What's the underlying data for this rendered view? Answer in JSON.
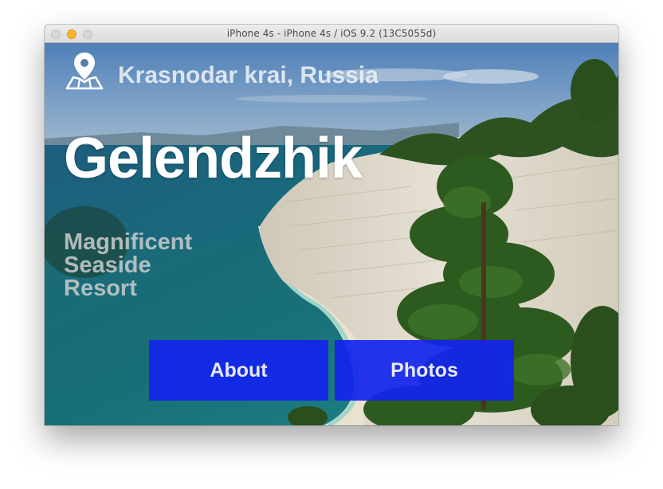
{
  "window": {
    "title": "iPhone 4s - iPhone 4s / iOS 9.2 (13C5055d)"
  },
  "screen": {
    "location": "Krasnodar krai, Russia",
    "location_icon": "map-pin-icon",
    "city": "Gelendzhik",
    "tagline": [
      "Magnificent",
      "Seaside",
      "Resort"
    ],
    "buttons": {
      "about": "About",
      "photos": "Photos"
    },
    "colors": {
      "button_bg": "#1224ee",
      "sea": "#1b7f86",
      "cliff": "#ddd6c8",
      "pine": "#2f5a1e"
    }
  }
}
